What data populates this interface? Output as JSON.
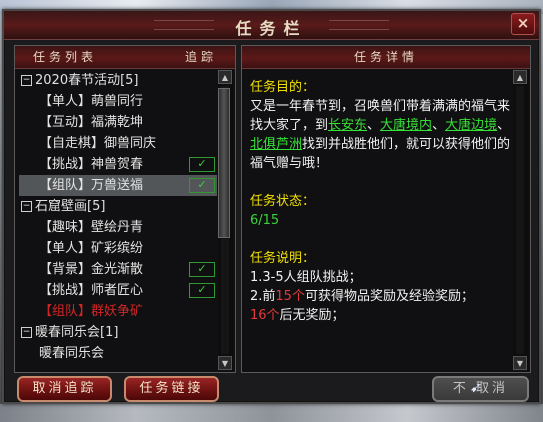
{
  "window": {
    "title": "任务栏",
    "close_label": "×"
  },
  "left_panel": {
    "header_list": "任务列表",
    "header_track": "追踪",
    "categories": [
      {
        "expander": "−",
        "label": "2020春节活动[5]",
        "items": [
          {
            "label": "【单人】萌兽同行",
            "tracked": false,
            "selected": false,
            "red": false
          },
          {
            "label": "【互动】福满乾坤",
            "tracked": false,
            "selected": false,
            "red": false
          },
          {
            "label": "【自走棋】御兽同庆",
            "tracked": false,
            "selected": false,
            "red": false
          },
          {
            "label": "【挑战】神兽贺春",
            "tracked": true,
            "selected": false,
            "red": false
          },
          {
            "label": "【组队】万兽送福",
            "tracked": true,
            "selected": true,
            "red": false
          }
        ]
      },
      {
        "expander": "−",
        "label": "石窟壁画[5]",
        "items": [
          {
            "label": "【趣味】壁绘丹青",
            "tracked": false,
            "selected": false,
            "red": false
          },
          {
            "label": "【单人】矿彩缤纷",
            "tracked": false,
            "selected": false,
            "red": false
          },
          {
            "label": "【背景】金光渐散",
            "tracked": true,
            "selected": false,
            "red": false
          },
          {
            "label": "【挑战】师者匠心",
            "tracked": true,
            "selected": false,
            "red": false
          },
          {
            "label": "【组队】群妖争矿",
            "tracked": false,
            "selected": false,
            "red": true
          }
        ]
      },
      {
        "expander": "−",
        "label": "暖春同乐会[1]",
        "items": [
          {
            "label": "暖春同乐会",
            "tracked": false,
            "selected": false,
            "red": false
          }
        ]
      }
    ],
    "tracked_mark": "✓"
  },
  "right_panel": {
    "header": "任务详情",
    "goal_title": "任务目的：",
    "goal_text_1": "又是一年春节到，召唤兽们带着满满的福气来找大家了，到",
    "loc_1": "长安东",
    "sep_1": "、",
    "loc_2": "大唐境内",
    "sep_2": "、",
    "loc_3": "大唐边境",
    "sep_3": "、",
    "loc_4": "北俱芦洲",
    "goal_text_2": "找到并战胜他们，就可以获得他们的福气赠与哦！",
    "status_title": "任务状态：",
    "status_value": "6/15",
    "desc_title": "任务说明：",
    "desc_line_1": "1.3-5人组队挑战；",
    "desc_line_2_a": "2.前",
    "desc_line_2_num": "15个",
    "desc_line_2_b": "可获得物品奖励及经验奖励；",
    "desc_line_3_num": "16个",
    "desc_line_3_b": "后无奖励；"
  },
  "buttons": {
    "untrack": "取消追踪",
    "task_link": "任务链接",
    "cancel": "不  取消"
  },
  "colors": {
    "title_bg": "#5a1a1a",
    "link_green": "#36e136",
    "section_yellow": "#f2e000",
    "warn_red": "#e43a3a"
  }
}
